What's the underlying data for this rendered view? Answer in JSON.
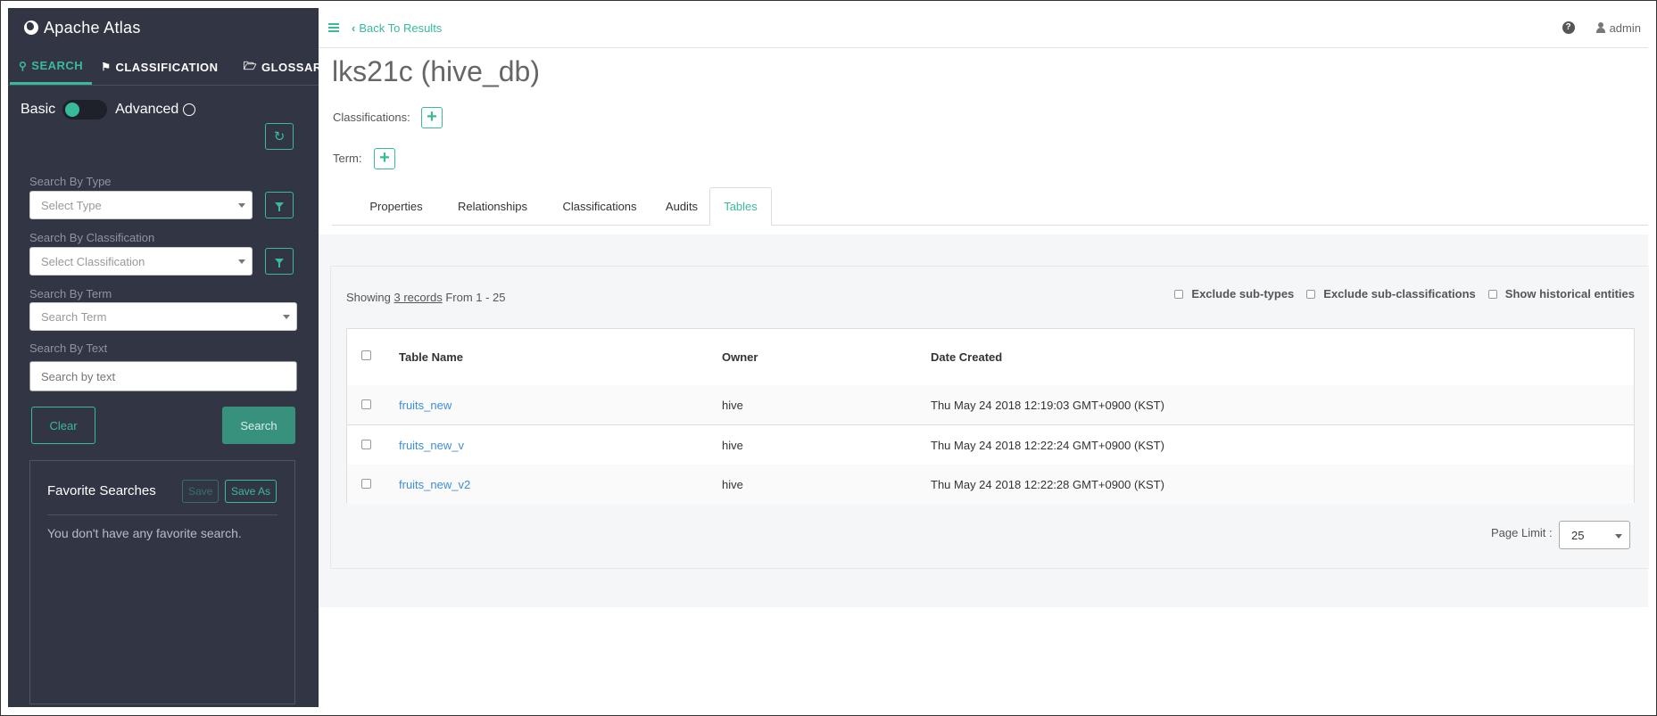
{
  "app": {
    "brand": "Apache Atlas"
  },
  "nav": {
    "tabs": [
      {
        "label": "SEARCH",
        "icon": "search-icon",
        "active": true
      },
      {
        "label": "CLASSIFICATION",
        "icon": "tags-icon",
        "active": false
      },
      {
        "label": "GLOSSARY",
        "icon": "folder-open-icon",
        "active": false
      }
    ]
  },
  "search": {
    "mode_basic": "Basic",
    "mode_advanced": "Advanced",
    "basic_selected": true,
    "type_label": "Search By Type",
    "type_placeholder": "Select Type",
    "classification_label": "Search By Classification",
    "classification_placeholder": "Select Classification",
    "term_label": "Search By Term",
    "term_placeholder": "Search Term",
    "text_label": "Search By Text",
    "text_placeholder": "Search by text",
    "clear_label": "Clear",
    "search_label": "Search"
  },
  "favorites": {
    "title": "Favorite Searches",
    "save_label": "Save",
    "save_as_label": "Save As",
    "empty_text": "You don't have any favorite search."
  },
  "topbar": {
    "back_label": "Back To Results",
    "user": "admin"
  },
  "entity": {
    "title": "lks21c (hive_db)",
    "classifications_label": "Classifications:",
    "term_label": "Term:"
  },
  "detail_tabs": [
    {
      "label": "Properties",
      "active": false
    },
    {
      "label": "Relationships",
      "active": false
    },
    {
      "label": "Classifications",
      "active": false
    },
    {
      "label": "Audits",
      "active": false
    },
    {
      "label": "Tables",
      "active": true
    }
  ],
  "results": {
    "showing_prefix": "Showing",
    "records_link": "3 records",
    "range_text": "From 1 - 25",
    "filters": [
      "Exclude sub-types",
      "Exclude sub-classifications",
      "Show historical entities"
    ],
    "columns": [
      "Table Name",
      "Owner",
      "Date Created"
    ],
    "rows": [
      {
        "name": "fruits_new",
        "owner": "hive",
        "created": "Thu May 24 2018 12:19:03 GMT+0900 (KST)"
      },
      {
        "name": "fruits_new_v",
        "owner": "hive",
        "created": "Thu May 24 2018 12:22:24 GMT+0900 (KST)"
      },
      {
        "name": "fruits_new_v2",
        "owner": "hive",
        "created": "Thu May 24 2018 12:22:28 GMT+0900 (KST)"
      }
    ],
    "page_limit_label": "Page Limit :",
    "page_limit_value": "25"
  },
  "colors": {
    "accent": "#38bb9b",
    "sidebar_bg": "#323544",
    "link": "#3d8ed8"
  }
}
